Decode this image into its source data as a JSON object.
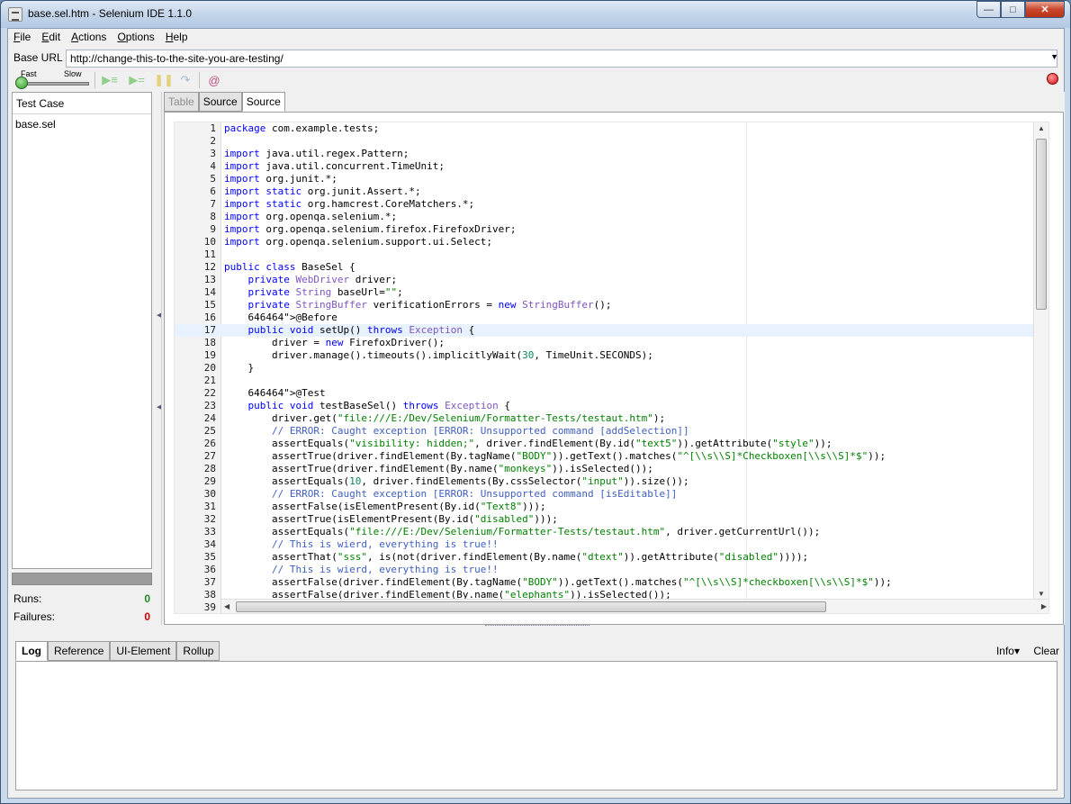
{
  "window": {
    "title": "base.sel.htm - Selenium IDE 1.1.0",
    "min": "—",
    "max": "□",
    "close": "✕"
  },
  "menu": [
    {
      "label": "File",
      "key": "F"
    },
    {
      "label": "Edit",
      "key": "E"
    },
    {
      "label": "Actions",
      "key": "A"
    },
    {
      "label": "Options",
      "key": "O"
    },
    {
      "label": "Help",
      "key": "H"
    }
  ],
  "url_bar": {
    "label": "Base URL",
    "value": "http://change-this-to-the-site-you-are-testing/"
  },
  "toolbar": {
    "fast_label": "Fast",
    "slow_label": "Slow"
  },
  "left": {
    "header": "Test Case",
    "items": [
      "base.sel"
    ],
    "runs_label": "Runs:",
    "runs_value": "0",
    "failures_label": "Failures:",
    "failures_value": "0"
  },
  "tabs": [
    {
      "label": "Table",
      "state": "disabled"
    },
    {
      "label": "Source",
      "state": "normal"
    },
    {
      "label": "Source",
      "state": "active"
    }
  ],
  "current_line": 17,
  "code": [
    "package com.example.tests;",
    "",
    "import java.util.regex.Pattern;",
    "import java.util.concurrent.TimeUnit;",
    "import org.junit.*;",
    "import static org.junit.Assert.*;",
    "import static org.hamcrest.CoreMatchers.*;",
    "import org.openqa.selenium.*;",
    "import org.openqa.selenium.firefox.FirefoxDriver;",
    "import org.openqa.selenium.support.ui.Select;",
    "",
    "public class BaseSel {",
    "    private WebDriver driver;",
    "    private String baseUrl=\"\";",
    "    private StringBuffer verificationErrors = new StringBuffer();",
    "    @Before",
    "    public void setUp() throws Exception {",
    "        driver = new FirefoxDriver();",
    "        driver.manage().timeouts().implicitlyWait(30, TimeUnit.SECONDS);",
    "    }",
    "",
    "    @Test",
    "    public void testBaseSel() throws Exception {",
    "        driver.get(\"file:///E:/Dev/Selenium/Formatter-Tests/testaut.htm\");",
    "        // ERROR: Caught exception [ERROR: Unsupported command [addSelection]]",
    "        assertEquals(\"visibility: hidden;\", driver.findElement(By.id(\"text5\")).getAttribute(\"style\"));",
    "        assertTrue(driver.findElement(By.tagName(\"BODY\")).getText().matches(\"^[\\\\s\\\\S]*Checkboxen[\\\\s\\\\S]*$\"));",
    "        assertTrue(driver.findElement(By.name(\"monkeys\")).isSelected());",
    "        assertEquals(10, driver.findElements(By.cssSelector(\"input\")).size());",
    "        // ERROR: Caught exception [ERROR: Unsupported command [isEditable]]",
    "        assertFalse(isElementPresent(By.id(\"Text8\")));",
    "        assertTrue(isElementPresent(By.id(\"disabled\")));",
    "        assertEquals(\"file:///E:/Dev/Selenium/Formatter-Tests/testaut.htm\", driver.getCurrentUrl());",
    "        // This is wierd, everything is true!!",
    "        assertThat(\"sss\", is(not(driver.findElement(By.name(\"dtext\")).getAttribute(\"disabled\"))));",
    "        // This is wierd, everything is true!!",
    "        assertFalse(driver.findElement(By.tagName(\"BODY\")).getText().matches(\"^[\\\\s\\\\S]*checkboxen[\\\\s\\\\S]*$\"));",
    "        assertFalse(driver.findElement(By.name(\"elephants\")).isSelected());",
    ""
  ],
  "log": {
    "tabs": [
      {
        "label": "Log",
        "active": true
      },
      {
        "label": "Reference",
        "active": false
      },
      {
        "label": "UI-Element",
        "active": false
      },
      {
        "label": "Rollup",
        "active": false
      }
    ],
    "info_label": "Info▾",
    "clear_label": "Clear"
  },
  "colors": {
    "keyword": "#0000ff",
    "string": "#008000",
    "comment": "#3f5fbf",
    "type": "#7f55c0",
    "annotation": "#646464",
    "number": "#098658",
    "runs_green": "#1f8a1f",
    "failures_red": "#d40000"
  }
}
